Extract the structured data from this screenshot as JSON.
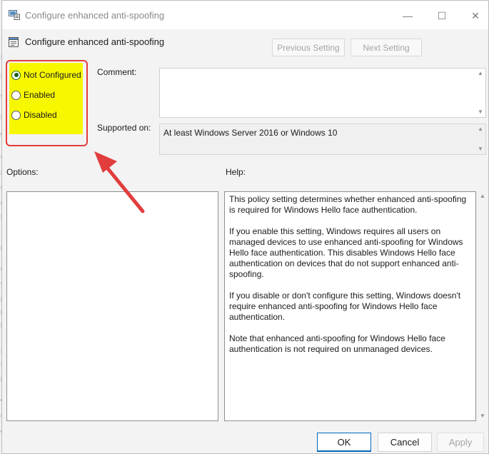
{
  "window": {
    "title": "Configure enhanced anti-spoofing",
    "controls": {
      "minimize": "—",
      "maximize": "☐",
      "close": "✕"
    }
  },
  "header": {
    "title": "Configure enhanced anti-spoofing",
    "previous_label": "Previous Setting",
    "next_label": "Next Setting"
  },
  "state": {
    "options": [
      "Not Configured",
      "Enabled",
      "Disabled"
    ],
    "selected": "Not Configured"
  },
  "comment": {
    "label": "Comment:",
    "value": ""
  },
  "supported": {
    "label": "Supported on:",
    "value": "At least Windows Server 2016 or Windows 10"
  },
  "options_panel": {
    "label": "Options:"
  },
  "help_panel": {
    "label": "Help:",
    "paragraphs": [
      "This policy setting determines whether enhanced anti-spoofing is required for Windows Hello face authentication.",
      "If you enable this setting, Windows requires all users on managed devices to use enhanced anti-spoofing for Windows Hello face authentication. This disables Windows Hello face authentication on devices that do not support enhanced anti-spoofing.",
      "If you disable or don't configure this setting, Windows doesn't require enhanced anti-spoofing for Windows Hello face authentication.",
      "Note that enhanced anti-spoofing for Windows Hello face authentication is not required on unmanaged devices."
    ]
  },
  "footer": {
    "ok_label": "OK",
    "cancel_label": "Cancel",
    "apply_label": "Apply"
  },
  "bg_letters": [
    "E",
    "i",
    "s",
    "i",
    "t",
    "r",
    "i",
    "r",
    "r",
    "l",
    "p",
    "r",
    "y",
    "p",
    "p",
    "p",
    "P",
    "L",
    "p",
    "c",
    "n",
    "c"
  ],
  "colors": {
    "highlight": "#f7f700",
    "annotation": "#e23d3d",
    "accent": "#0067c0"
  }
}
